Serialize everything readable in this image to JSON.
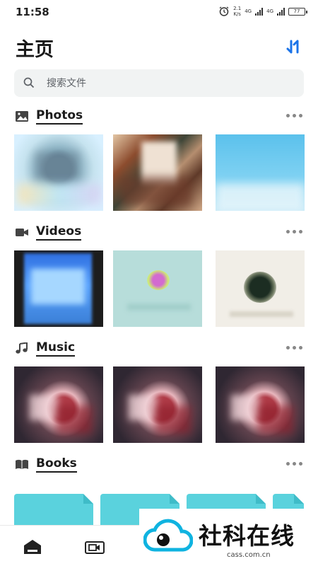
{
  "status_bar": {
    "time": "11:58",
    "speed_value": "2.1",
    "speed_unit": "K/s",
    "network_1": "4G",
    "network_2": "4G",
    "battery": "77",
    "icons": [
      "alarm-icon",
      "signal-icon",
      "battery-icon"
    ]
  },
  "header": {
    "title": "主页",
    "sort_icon": "sort-arrows-icon",
    "accent_color": "#1a73e8"
  },
  "search": {
    "placeholder": "搜索文件",
    "icon": "search-icon"
  },
  "sections": [
    {
      "key": "photos",
      "title": "Photos",
      "icon": "image-icon",
      "more_icon": "more-horizontal-icon"
    },
    {
      "key": "videos",
      "title": "Videos",
      "icon": "videocam-icon",
      "more_icon": "more-horizontal-icon"
    },
    {
      "key": "music",
      "title": "Music",
      "icon": "music-note-icon",
      "more_icon": "more-horizontal-icon"
    },
    {
      "key": "books",
      "title": "Books",
      "icon": "book-open-icon",
      "more_icon": "more-horizontal-icon"
    }
  ],
  "bottom_nav": {
    "items": [
      {
        "icon": "home-icon",
        "selected": true
      },
      {
        "icon": "video-folder-icon",
        "selected": false
      }
    ]
  },
  "watermark": {
    "name": "社科在线",
    "url": "cass.com.cn",
    "icon": "cloud-eye-logo-icon"
  }
}
